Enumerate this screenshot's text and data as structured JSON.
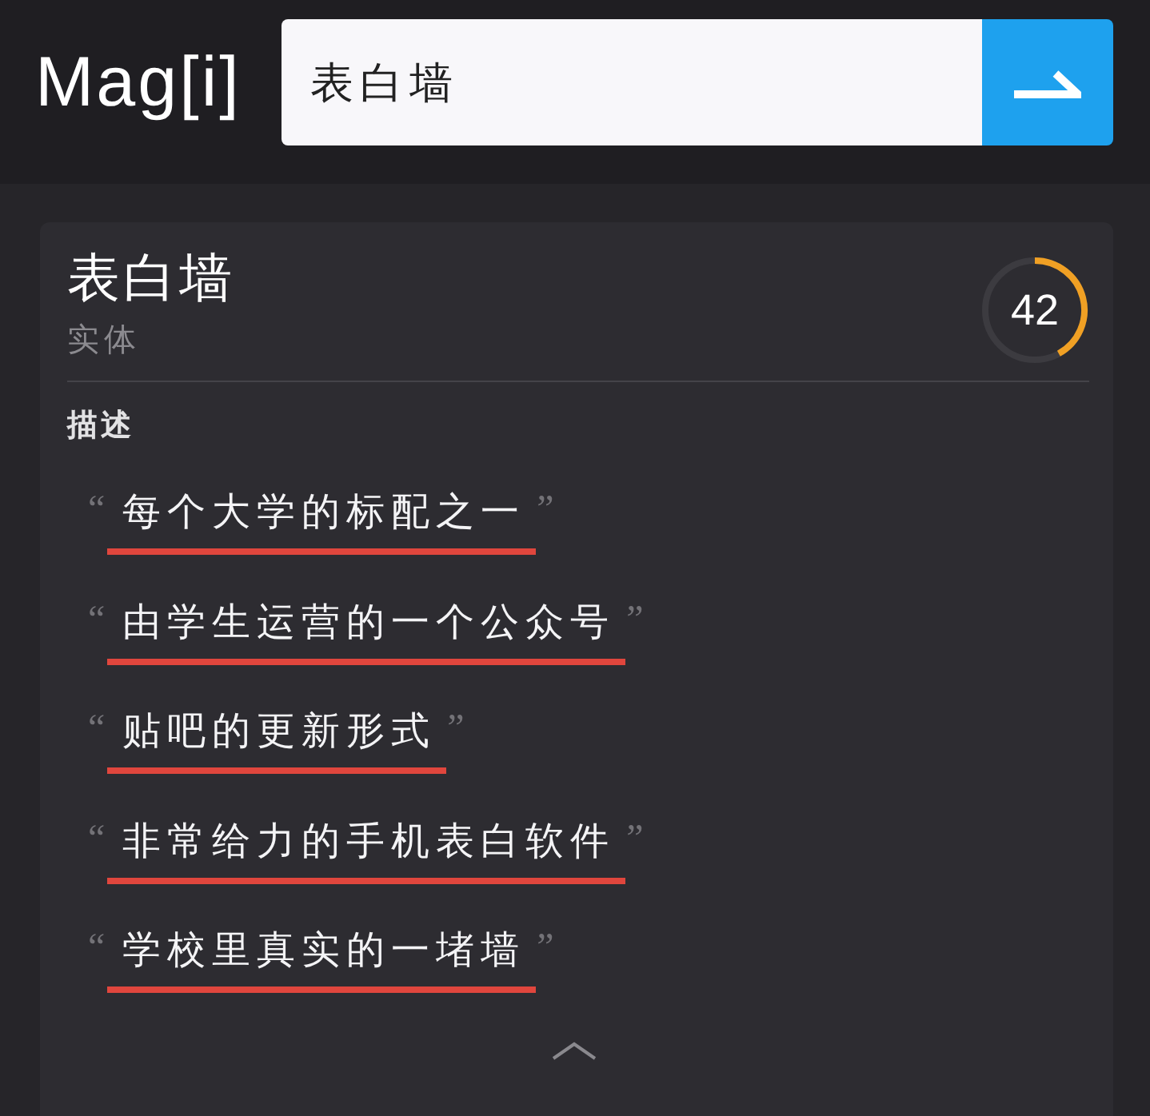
{
  "header": {
    "logo": "Mag[i]",
    "search": {
      "value": "表白墙"
    }
  },
  "entity": {
    "title": "表白墙",
    "type": "实体",
    "score": {
      "value": "42",
      "level": 0.42
    }
  },
  "description": {
    "heading": "描述",
    "items": [
      {
        "open_quote": "“",
        "text": "每个大学的标配之一",
        "close_quote": "”",
        "underlined": true
      },
      {
        "open_quote": "“",
        "text": "由学生运营的一个公众号",
        "close_quote": "”",
        "underlined": true
      },
      {
        "open_quote": "“",
        "text": "贴吧的更新形式",
        "close_quote": "”",
        "underlined": true
      },
      {
        "open_quote": "“",
        "text": "非常给力的手机表白软件",
        "close_quote": "”",
        "underlined": true
      },
      {
        "open_quote": "“",
        "text": "学校里真实的一堵墙",
        "close_quote": "”",
        "underlined": true
      }
    ]
  }
}
